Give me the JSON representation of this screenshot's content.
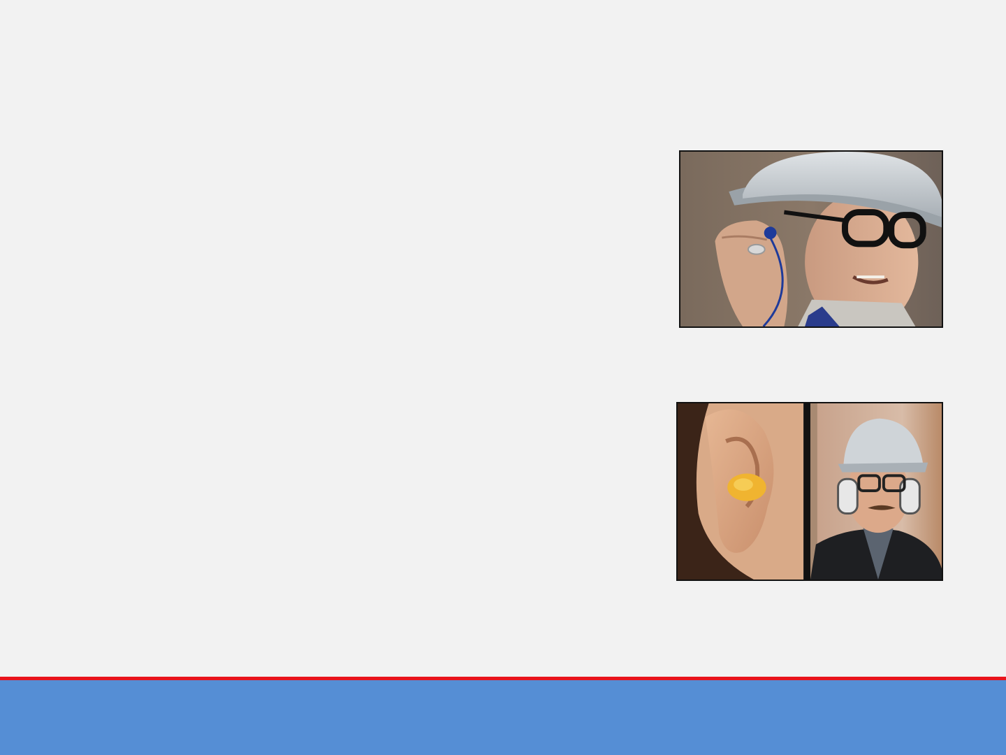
{
  "slide": {
    "background_color": "#f2f2f2",
    "images": [
      {
        "name": "worker-inserting-earplug-photo",
        "description_icon": "earplug-insertion-photo"
      },
      {
        "name": "earplug-and-earmuffs-photo",
        "description_icon": "hearing-protection-photo"
      }
    ]
  },
  "footer": {
    "line_color": "#e8141c",
    "band_color": "#558ed5"
  }
}
